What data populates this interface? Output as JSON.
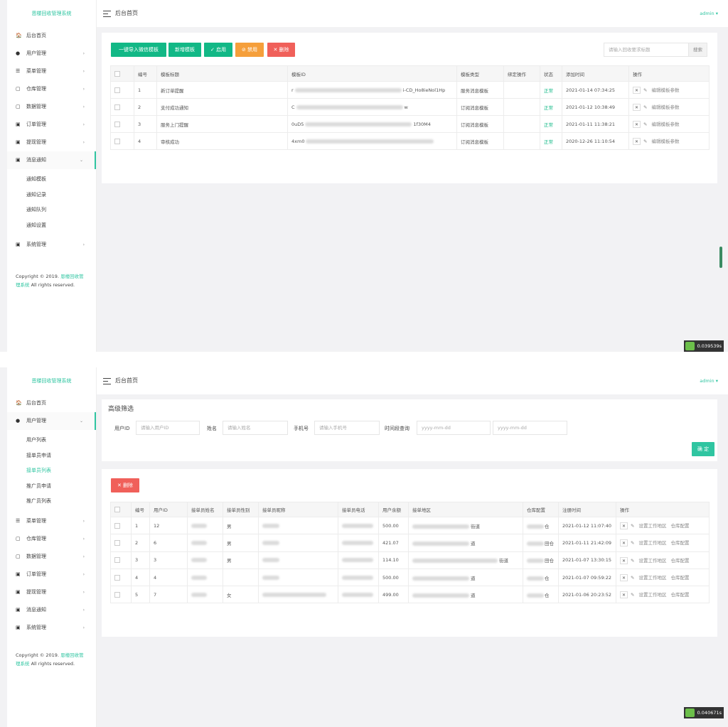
{
  "brand": "恩楼回收管理系统",
  "top_title": "后台首页",
  "admin": "admin ▾",
  "copyright": {
    "text1": "Copyright © 2019.",
    "brand": "恩楼回收管理系统",
    "text2": "All rights reserved."
  },
  "icons": {
    "home": "home-icon",
    "menu": "menu-icon",
    "ico": "generic-nav-icon",
    "arrow": "chevron-right-icon",
    "edit": "edit-icon",
    "close": "close-icon"
  },
  "colors": {
    "accent": "#2fc5a1",
    "green": "#12b886",
    "orange": "#f59f3b",
    "red": "#f0605a"
  },
  "s1": {
    "nav": [
      {
        "icon": "🏠",
        "label": "后台首页",
        "arrow": ""
      },
      {
        "icon": "●",
        "label": "用户管理",
        "arrow": "›"
      },
      {
        "icon": "☰",
        "label": "菜单管理",
        "arrow": "›"
      },
      {
        "icon": "▢",
        "label": "仓库管理",
        "arrow": "›"
      },
      {
        "icon": "▢",
        "label": "数据管理",
        "arrow": "›"
      },
      {
        "icon": "▣",
        "label": "订单管理",
        "arrow": "›"
      },
      {
        "icon": "▣",
        "label": "提现管理",
        "arrow": "›"
      },
      {
        "icon": "▣",
        "label": "消息通知",
        "arrow": "⌄"
      }
    ],
    "sub": [
      "通知模板",
      "通知记录",
      "通知队列",
      "通知设置"
    ],
    "nav_after": {
      "icon": "▣",
      "label": "系统管理",
      "arrow": "›"
    },
    "buttons": {
      "import": "一键导入微信模板",
      "add": "新增模板",
      "enable": "✓ 启用",
      "disable": "⊘ 禁用",
      "delete": "✕ 删除"
    },
    "search": {
      "placeholder": "请输入回收要求标题",
      "button": "搜索"
    },
    "headers": [
      "编号",
      "模板标题",
      "模板ID",
      "模板类型",
      "绑定操作",
      "状态",
      "添加时间",
      "操作"
    ],
    "rows": [
      {
        "id": "1",
        "title": "新订单提醒",
        "tid_a": "r",
        "tid_b": "i-CD_Ho8ieNol1Hp",
        "type": "服务消息模板",
        "status": "正常",
        "time": "2021-01-14 07:34:25",
        "edit": "编辑模板参数"
      },
      {
        "id": "2",
        "title": "支付成功通知",
        "tid_a": "C",
        "tid_b": "w",
        "type": "订阅消息模板",
        "status": "正常",
        "time": "2021-01-12 10:38:49",
        "edit": "编辑模板参数"
      },
      {
        "id": "3",
        "title": "服务上门提醒",
        "tid_a": "0uD5",
        "tid_b": "1f30M4",
        "type": "订阅消息模板",
        "status": "正常",
        "time": "2021-01-11 11:38:21",
        "edit": "编辑模板参数"
      },
      {
        "id": "4",
        "title": "审核成功",
        "tid_a": "4xm0",
        "tid_b": "",
        "type": "订阅消息模板",
        "status": "正常",
        "time": "2020-12-26 11:10:54",
        "edit": "编辑模板参数"
      }
    ],
    "timer": "0.039539s"
  },
  "s2": {
    "nav_before": [
      {
        "icon": "🏠",
        "label": "后台首页",
        "arrow": ""
      },
      {
        "icon": "●",
        "label": "用户管理",
        "arrow": "⌄"
      }
    ],
    "sub": [
      "用户列表",
      "接单员申请",
      "接单员列表",
      "推广员申请",
      "推广员列表"
    ],
    "nav_after": [
      {
        "icon": "☰",
        "label": "菜单管理",
        "arrow": "›"
      },
      {
        "icon": "▢",
        "label": "仓库管理",
        "arrow": "›"
      },
      {
        "icon": "▢",
        "label": "数据管理",
        "arrow": "›"
      },
      {
        "icon": "▣",
        "label": "订单管理",
        "arrow": "›"
      },
      {
        "icon": "▣",
        "label": "提现管理",
        "arrow": "›"
      },
      {
        "icon": "▣",
        "label": "消息通知",
        "arrow": "›"
      },
      {
        "icon": "▣",
        "label": "系统管理",
        "arrow": "›"
      }
    ],
    "filter": {
      "title": "高级筛选",
      "uid_label": "用户ID",
      "uid_ph": "请输入用户ID",
      "name_label": "姓名",
      "name_ph": "请输入姓名",
      "phone_label": "手机号",
      "phone_ph": "请输入手机号",
      "time_label": "时间段查询",
      "date_ph1": "yyyy-mm-dd",
      "date_ph2": "yyyy-mm-dd",
      "confirm": "确 定"
    },
    "delete": "✕ 删除",
    "headers": [
      "编号",
      "用户ID",
      "接单员姓名",
      "接单员性别",
      "接单员昵称",
      "接单员电话",
      "用户余额",
      "接单地区",
      "仓库配置",
      "注册时间",
      "操作"
    ],
    "rows": [
      {
        "id": "1",
        "uid": "12",
        "gender": "男",
        "bal": "500.00",
        "area": "街道",
        "wh": "仓",
        "time": "2021-01-12 11:07:40"
      },
      {
        "id": "2",
        "uid": "6",
        "gender": "男",
        "bal": "421.07",
        "area": "道",
        "wh": "田仓",
        "time": "2021-01-11 21:42:09"
      },
      {
        "id": "3",
        "uid": "3",
        "gender": "男",
        "bal": "114.10",
        "area": "街道",
        "wh": "田仓",
        "time": "2021-01-07 13:30:15"
      },
      {
        "id": "4",
        "uid": "4",
        "gender": "",
        "bal": "500.00",
        "area": "道",
        "wh": "仓",
        "time": "2021-01-07 09:59:22"
      },
      {
        "id": "5",
        "uid": "7",
        "gender": "女",
        "bal": "499.00",
        "area": "道",
        "wh": "仓",
        "time": "2021-01-06 20:23:52"
      }
    ],
    "ops": {
      "set_area": "设置工作地区",
      "wh_cfg": "仓库配置"
    },
    "timer": "0.040671s"
  }
}
